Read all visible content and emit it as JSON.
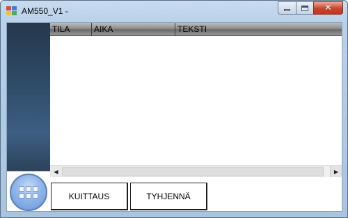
{
  "window": {
    "title": "AM550_V1 -",
    "controls": {
      "minimize": "–",
      "maximize": "□",
      "close": "✕"
    }
  },
  "list": {
    "columns": [
      "TILA",
      "AIKA",
      "TEKSTI"
    ],
    "rows": []
  },
  "scrollbar": {
    "left_arrow": "◀",
    "right_arrow": "▶"
  },
  "buttons": {
    "acknowledge": "KUITTAUS",
    "clear": "TYHJENNÄ"
  },
  "colors": {
    "side_panel": "#2f4a66",
    "header": "#8e8e8e",
    "menu_button": "#8fb5ea"
  }
}
